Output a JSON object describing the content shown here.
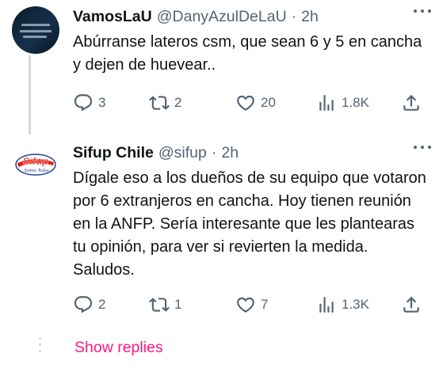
{
  "tweets": [
    {
      "name": "VamosLaU",
      "handle": "@DanyAzulDeLaU",
      "separator": "·",
      "time": "2h",
      "text": "Abúrranse lateros csm, que sean 6 y 5 en cancha y dejen de huevear..",
      "avatar_icon": "profile-photo-icon",
      "stats": {
        "replies": "3",
        "retweets": "2",
        "likes": "20",
        "views": "1.8K"
      }
    },
    {
      "name": "Sifup Chile",
      "handle": "@sifup",
      "separator": "·",
      "time": "2h",
      "text": "Dígale eso a los dueños de su equipo que votaron por 6 extranjeros en cancha. Hoy tienen reunión en la ANFP. Sería interesante que les plantearas tu opinión, para ver si revierten la medida. Saludos.",
      "avatar_icon": "sifup-logo-icon",
      "avatar_logo": {
        "title": "Sifup",
        "tagline": "Somos Todos"
      },
      "stats": {
        "replies": "2",
        "retweets": "1",
        "likes": "7",
        "views": "1.3K"
      }
    }
  ],
  "show_replies_label": "Show replies",
  "colors": {
    "accent_pink": "#f91880",
    "secondary_text": "#536471",
    "primary_text": "#0f1419",
    "logo_red": "#e1251b",
    "logo_blue": "#1d3f8f"
  }
}
